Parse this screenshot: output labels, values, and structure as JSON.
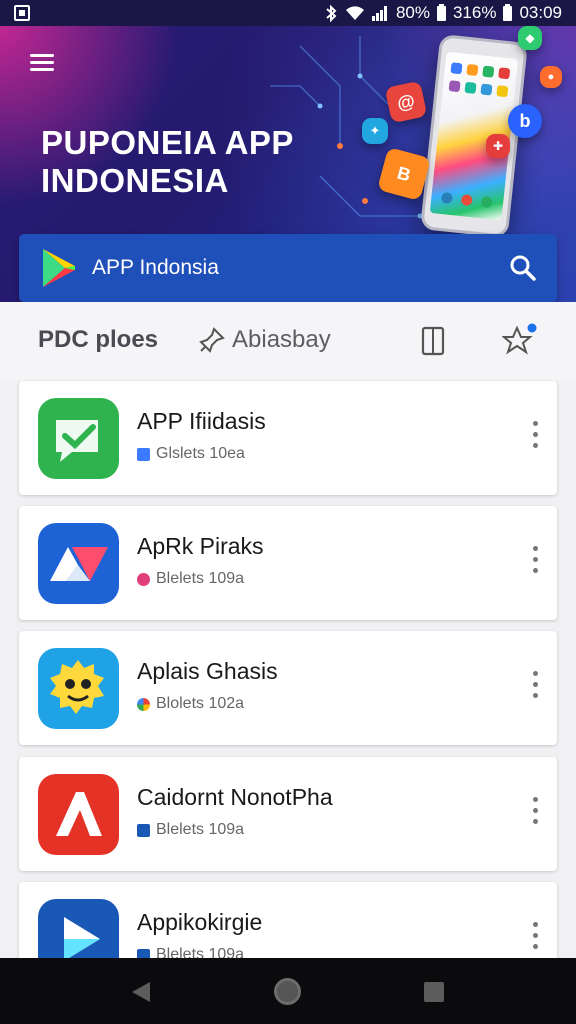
{
  "status_bar": {
    "battery_left": "80%",
    "battery_right": "316%",
    "time": "03:09",
    "icons": [
      "notification-icon",
      "bluetooth-icon",
      "wifi-icon",
      "signal-icon",
      "battery-icon"
    ]
  },
  "hero": {
    "title_line1": "PUPONEIA APP",
    "title_line2": "INDONESIA"
  },
  "search": {
    "text": "APP Indonsia"
  },
  "tabs": {
    "primary": "PDC ploes",
    "secondary": "Abiasbay"
  },
  "apps": [
    {
      "name": "APP Ifiidasis",
      "meta": "Glslets 10ea",
      "icon": "green-check-icon",
      "color": "#2eb34e"
    },
    {
      "name": "ApRk Piraks",
      "meta": "Blelets 109a",
      "icon": "av-logo-icon",
      "color": "#1e63d6"
    },
    {
      "name": "Aplais Ghasis",
      "meta": "Blolets 102a",
      "icon": "yellow-face-icon",
      "color": "#1fa2e6"
    },
    {
      "name": "Caidornt NonotPha",
      "meta": "Blelets 109a",
      "icon": "red-a-icon",
      "color": "#e53227"
    },
    {
      "name": "Appikokirgie",
      "meta": "Blelets 109a",
      "icon": "blue-play-icon",
      "color": "#1a58b6"
    }
  ],
  "colors": {
    "accent": "#1f4fb9",
    "hero_dark": "#241a6e",
    "background": "#f1f1f3"
  }
}
